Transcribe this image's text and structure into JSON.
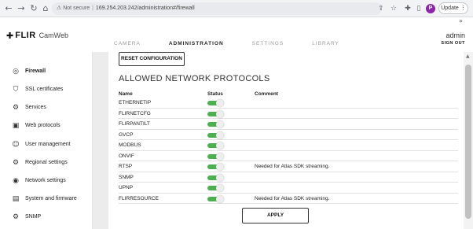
{
  "browser": {
    "not_secure": "Not secure",
    "url_host": "169.254.203.242",
    "url_path": "/administration#/firewall",
    "profile_initial": "P",
    "update_label": "Update",
    "update_menu": "⋮",
    "more_chevron": "»"
  },
  "header": {
    "brand": "FLIR",
    "product": "CamWeb",
    "tabs": [
      "CAMERA",
      "ADMINISTRATION",
      "SETTINGS",
      "LIBRARY"
    ],
    "active_tab": "ADMINISTRATION",
    "user": "admin",
    "sign_out": "SIGN OUT"
  },
  "sidebar": {
    "items": [
      {
        "label": "Firewall",
        "icon": "globe-icon",
        "active": true
      },
      {
        "label": "SSL certificates",
        "icon": "shield-icon",
        "active": false
      },
      {
        "label": "Services",
        "icon": "gears-icon",
        "active": false
      },
      {
        "label": "Web protocols",
        "icon": "web-icon",
        "active": false
      },
      {
        "label": "User management",
        "icon": "user-icon",
        "active": false
      },
      {
        "label": "Regional settings",
        "icon": "regional-icon",
        "active": false
      },
      {
        "label": "Network settings",
        "icon": "network-icon",
        "active": false
      },
      {
        "label": "System and firmware",
        "icon": "system-icon",
        "active": false
      },
      {
        "label": "SNMP",
        "icon": "snmp-icon",
        "active": false
      }
    ]
  },
  "main": {
    "reset_button": "RESET CONFIGURATION",
    "section_title": "ALLOWED NETWORK PROTOCOLS",
    "columns": {
      "name": "Name",
      "status": "Status",
      "comment": "Comment"
    },
    "protocols": [
      {
        "name": "ETHERNETIP",
        "enabled": true,
        "comment": ""
      },
      {
        "name": "FLIRNETCFG",
        "enabled": true,
        "comment": ""
      },
      {
        "name": "FLIRPANTILT",
        "enabled": true,
        "comment": ""
      },
      {
        "name": "GVCP",
        "enabled": true,
        "comment": ""
      },
      {
        "name": "MODBUS",
        "enabled": true,
        "comment": ""
      },
      {
        "name": "ONVIF",
        "enabled": true,
        "comment": ""
      },
      {
        "name": "RTSP",
        "enabled": true,
        "comment": "Needed for Atlas SDK streaming."
      },
      {
        "name": "SNMP",
        "enabled": true,
        "comment": ""
      },
      {
        "name": "UPNP",
        "enabled": true,
        "comment": ""
      },
      {
        "name": "FLIRRESOURCE",
        "enabled": true,
        "comment": "Needed for Atlas SDK streaming."
      }
    ],
    "apply_button": "APPLY"
  },
  "colors": {
    "toggle_on": "#4caf50",
    "profile": "#8e24aa"
  }
}
